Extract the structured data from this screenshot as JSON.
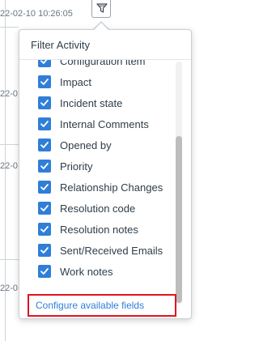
{
  "background": {
    "timestamp": "22-02-10 10:26:05",
    "fragments": [
      "22-0",
      "22-0",
      "22-0"
    ]
  },
  "filter_button": {
    "icon": "filter-icon"
  },
  "popup": {
    "title": "Filter Activity",
    "items": [
      {
        "label": "Configuration item",
        "checked": true
      },
      {
        "label": "Impact",
        "checked": true
      },
      {
        "label": "Incident state",
        "checked": true
      },
      {
        "label": "Internal Comments",
        "checked": true
      },
      {
        "label": "Opened by",
        "checked": true
      },
      {
        "label": "Priority",
        "checked": true
      },
      {
        "label": "Relationship Changes",
        "checked": true
      },
      {
        "label": "Resolution code",
        "checked": true
      },
      {
        "label": "Resolution notes",
        "checked": true
      },
      {
        "label": "Sent/Received Emails",
        "checked": true
      },
      {
        "label": "Work notes",
        "checked": true
      }
    ],
    "footer_link": "Configure available fields"
  },
  "colors": {
    "accent": "#2f7ed8",
    "highlight_border": "#e0141e"
  }
}
